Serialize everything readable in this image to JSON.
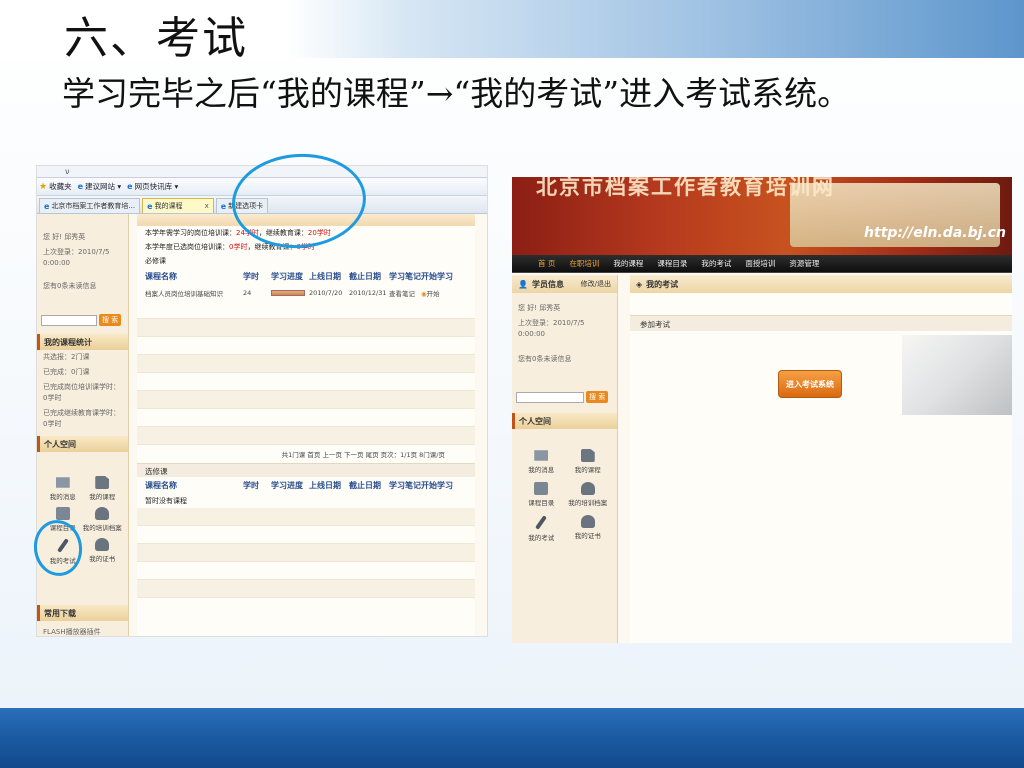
{
  "slide": {
    "title": "六、考试",
    "subtitle": "学习完毕之后“我的课程”→“我的考试”进入考试系统。"
  },
  "left_screenshot": {
    "address_hint": "ν",
    "bookmarks_bar": [
      "收藏夹",
      "建议网站 ▾",
      "网页快讯库 ▾"
    ],
    "tabs": [
      {
        "label": "北京市档案工作者教育培..."
      },
      {
        "label": "我的课程",
        "active": true
      },
      {
        "label": "新建选项卡"
      }
    ],
    "sidebar": {
      "greeting": "您 好! 邱秀英",
      "last_login": "上次登录：2010/7/5 0:00:00",
      "unread": "您有0条未读信息",
      "search_button": "搜 索",
      "stats_title": "我的课程统计",
      "stats": [
        "共选报：2门课",
        "已完成：0门课",
        "已完成岗位培训课学时：0学时",
        "已完成继续教育课学时：0学时"
      ],
      "space_title": "个人空间",
      "icons": [
        {
          "label": "我的消息",
          "icon": "envelope-icon"
        },
        {
          "label": "我的课程",
          "icon": "document-icon"
        },
        {
          "label": "课程目录",
          "icon": "list-icon"
        },
        {
          "label": "我的培训档案",
          "icon": "heart-icon"
        },
        {
          "label": "我的考试",
          "icon": "pen-icon"
        },
        {
          "label": "我的证书",
          "icon": "certificate-icon"
        }
      ],
      "downloads_title": "常用下载",
      "download_item": "FLASH播放器插件"
    },
    "main": {
      "line1": {
        "text_a": "本学年需学习的岗位培训课：",
        "val_a": "24学时",
        "text_b": "，继续教育课：",
        "val_b": "20学时"
      },
      "line2": {
        "text_a": "本学年度已选岗位培训课：",
        "val_a": "0学时",
        "text_b": "，继续教育课：",
        "val_b": "0学时"
      },
      "required_label": "必修课",
      "columns": [
        "课程名称",
        "学时",
        "学习进度",
        "上线日期",
        "截止日期",
        "学习笔记",
        "开始学习"
      ],
      "rows": [
        {
          "name": "档案人员岗位培训基础知识",
          "hours": "24",
          "progress": 1.0,
          "online": "2010/7/20",
          "deadline": "2010/12/31",
          "notes": "查看笔记",
          "start": "开始"
        }
      ],
      "pager": "共1门课  首页  上一页  下一页  尾页  页次：1/1页  8门课/页",
      "elective_label": "选修课",
      "elective_columns": [
        "课程名称",
        "学时",
        "学习进度",
        "上线日期",
        "截止日期",
        "学习笔记",
        "开始学习"
      ],
      "elective_empty": "暂时没有课程"
    }
  },
  "right_screenshot": {
    "banner_title": "北京市档案工作者教育培训网",
    "banner_url": "http://eln.da.bj.cn",
    "nav": [
      "首 页",
      "在职培训",
      "我的课程",
      "课程目录",
      "我的考试",
      "面授培训",
      "资源管理"
    ],
    "sidebar": {
      "head": "学员信息",
      "head_link": "修改/退出",
      "greeting": "您 好! 邱秀英",
      "last_login": "上次登录：2010/7/5 0:00:00",
      "unread": "您有0条未读信息",
      "search_button": "搜 索",
      "space_title": "个人空间",
      "icons": [
        {
          "label": "我的消息",
          "icon": "envelope-icon"
        },
        {
          "label": "我的课程",
          "icon": "document-icon"
        },
        {
          "label": "课程目录",
          "icon": "list-icon"
        },
        {
          "label": "我的培训档案",
          "icon": "heart-icon"
        },
        {
          "label": "我的考试",
          "icon": "pen-icon"
        },
        {
          "label": "我的证书",
          "icon": "certificate-icon"
        }
      ]
    },
    "main": {
      "head": "我的考试",
      "sub": "参加考试",
      "enter_button": "进入考试系统"
    }
  },
  "colors": {
    "highlight_circle": "#1e9be0",
    "accent_orange": "#e98a1f",
    "bottom_band": "#1b5aa2"
  }
}
